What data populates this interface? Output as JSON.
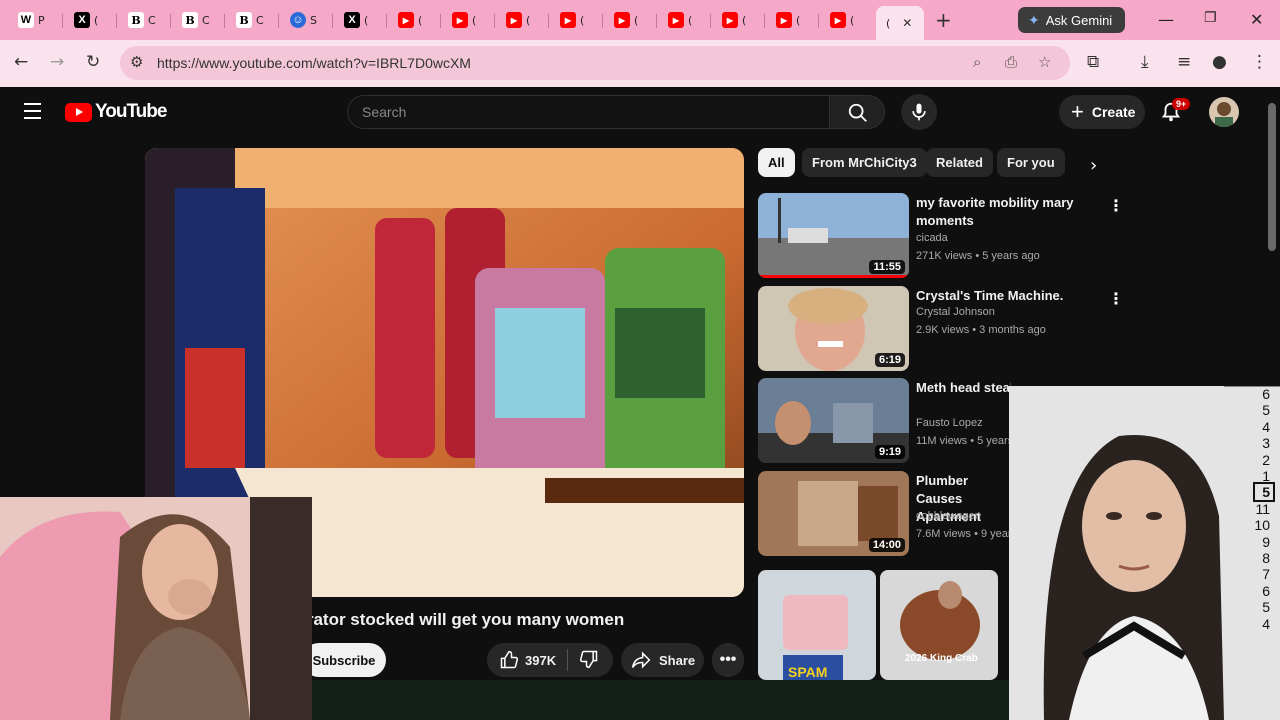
{
  "browser": {
    "tabs": [
      {
        "favicon": "wiki-w-icon",
        "title": "P"
      },
      {
        "favicon": "x-icon",
        "title": "("
      },
      {
        "favicon": "b-icon",
        "title": "C"
      },
      {
        "favicon": "b-icon",
        "title": "C"
      },
      {
        "favicon": "b-icon",
        "title": "C"
      },
      {
        "favicon": "emoji-icon",
        "title": "S"
      },
      {
        "favicon": "x-icon",
        "title": "("
      },
      {
        "favicon": "youtube-icon",
        "title": "("
      },
      {
        "favicon": "youtube-icon",
        "title": "("
      },
      {
        "favicon": "youtube-icon",
        "title": "("
      },
      {
        "favicon": "youtube-icon",
        "title": "("
      },
      {
        "favicon": "youtube-icon",
        "title": "("
      },
      {
        "favicon": "youtube-icon",
        "title": "("
      },
      {
        "favicon": "youtube-icon",
        "title": "("
      },
      {
        "favicon": "youtube-icon",
        "title": "("
      },
      {
        "favicon": "youtube-icon",
        "title": "("
      }
    ],
    "active_tab_title": "(",
    "ask_gemini": "Ask Gemini",
    "url": "https://www.youtube.com/watch?v=IBRL7D0wcXM"
  },
  "youtube": {
    "logo_text": "YouTube",
    "search_placeholder": "Search",
    "create_label": "Create",
    "notification_count": "9+",
    "video_title": "frigerator stocked will get you many women",
    "subscribe_label": "Subscribe",
    "likes": "397K",
    "share_label": "Share",
    "chips": [
      "All",
      "From MrChiCity3",
      "Related",
      "For you"
    ],
    "recommendations": [
      {
        "title": "my favorite mobility mary moments",
        "channel": "cicada",
        "views": "271K views",
        "age": "5 years ago",
        "duration": "11:55",
        "watched": 1.0
      },
      {
        "title": "Crystal's Time Machine.",
        "channel": "Crystal Johnson",
        "views": "2.9K views",
        "age": "3 months ago",
        "duration": "6:19"
      },
      {
        "title": "Meth head steals during delivery in",
        "channel": "Fausto Lopez",
        "views": "11M views",
        "age": "5 years",
        "duration": "9:19"
      },
      {
        "title": "Plumber Causes Apartment",
        "channel": "cobblewagen",
        "views": "7.6M views",
        "age": "9 years",
        "duration": "14:00"
      }
    ],
    "shorts": [
      {
        "label": "SPAM"
      },
      {
        "label": "2026 King Crab"
      }
    ]
  },
  "colors": {
    "tabstrip": "#f6a8c8",
    "toolbar": "#fbe3ee",
    "youtube_red": "#ff0000",
    "yt_background": "#0f0f0f"
  }
}
